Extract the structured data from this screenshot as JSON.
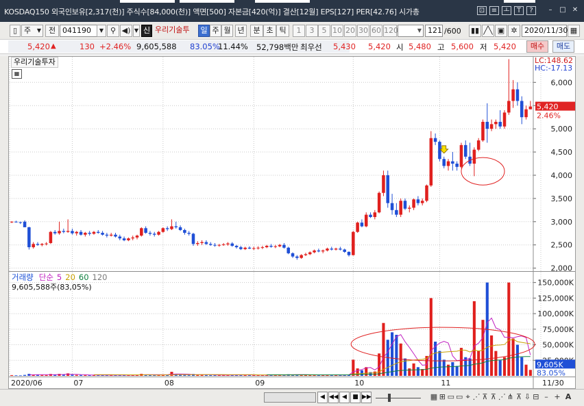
{
  "titlebar": {
    "text": "KOSDAQ150  외국인보유[2,317(천)]  주식수[84,000(천)]  액면[500]  자본금[420(억)]  결산[12월]  EPS[127]  PER[42.76]  시가총",
    "buttons": [
      "⊡",
      "≡",
      "ㅗ",
      "T",
      "?"
    ],
    "window_buttons": [
      "–",
      "□",
      "✕"
    ]
  },
  "toolbar": {
    "period_label": "주",
    "prev_label": "전",
    "code_value": "041190",
    "new_label": "신",
    "company_name": "우리기술투",
    "periods": [
      "일",
      "주",
      "월",
      "년",
      "분",
      "초",
      "틱"
    ],
    "active_period": "일",
    "intervals": [
      "1",
      "3",
      "5",
      "10",
      "20",
      "30",
      "60",
      "120"
    ],
    "count_value": "121",
    "count_total": "/600",
    "date_value": "2020/11/30"
  },
  "quote": {
    "price": "5,420",
    "change": "130",
    "change_pct": "+2.46%",
    "volume": "9,605,588",
    "vol_ratio": "83.05%",
    "turnover": "11.44%",
    "amount": "52,798백만",
    "best_ask_label": "최우선",
    "best_ask": "5,430",
    "best_bid": "5,420",
    "open_label": "시",
    "open": "5,480",
    "high_label": "고",
    "high": "5,600",
    "low_label": "저",
    "low": "5,420",
    "buy_label": "매수",
    "sell_label": "매도"
  },
  "bottombar": {
    "nav": [
      "◀",
      "▶▶",
      "◀",
      "■",
      "▶▶"
    ],
    "tools": [
      "▦",
      "⊞",
      "▭",
      "▭",
      "⌖",
      "⋰",
      "⊼",
      "⊼",
      "⋰",
      "⋔",
      "⊼",
      "⇩",
      "⊟"
    ],
    "zoom_minus": "–",
    "zoom_plus": "+",
    "text_tool": "A"
  },
  "chart_data": [
    {
      "type": "candlestick",
      "title": "우리기술투자",
      "annotations": {
        "lc": "LC:148.62",
        "hc": "HC:-17.13"
      },
      "last_price_label": "5,420",
      "last_change_label": "2.46%",
      "ylim": [
        1950,
        6550
      ],
      "yticks": [
        2000,
        2500,
        3000,
        3500,
        4000,
        4500,
        5000,
        5500,
        6000
      ],
      "ytick_labels": [
        "2,000",
        "2,500",
        "3,000",
        "3,500",
        "4,000",
        "4,500",
        "5,000",
        "5,500",
        "6,000"
      ],
      "x_labels": [
        {
          "text": "2020/06",
          "i": 0
        },
        {
          "text": "07",
          "i": 14
        },
        {
          "text": "08",
          "i": 35
        },
        {
          "text": "09",
          "i": 56
        },
        {
          "text": "10",
          "i": 79
        },
        {
          "text": "11",
          "i": 99
        },
        {
          "text": "11/30",
          "i": 120
        }
      ],
      "candles": [
        [
          2990,
          3010,
          2970,
          3000
        ],
        [
          3000,
          3020,
          2980,
          2990
        ],
        [
          2990,
          3000,
          2950,
          2980
        ],
        [
          3000,
          3030,
          2960,
          2880
        ],
        [
          2880,
          2890,
          2400,
          2450
        ],
        [
          2450,
          2560,
          2420,
          2520
        ],
        [
          2520,
          2560,
          2480,
          2500
        ],
        [
          2500,
          2540,
          2470,
          2520
        ],
        [
          2520,
          2560,
          2490,
          2530
        ],
        [
          2540,
          2800,
          2520,
          2780
        ],
        [
          2780,
          2820,
          2720,
          2750
        ],
        [
          2750,
          3000,
          2720,
          2800
        ],
        [
          2800,
          2850,
          2750,
          2780
        ],
        [
          2780,
          3050,
          2760,
          2800
        ],
        [
          2800,
          2850,
          2720,
          2750
        ],
        [
          2750,
          2800,
          2700,
          2780
        ],
        [
          2780,
          2820,
          2700,
          2720
        ],
        [
          2720,
          2780,
          2680,
          2760
        ],
        [
          2760,
          2800,
          2700,
          2740
        ],
        [
          2740,
          2800,
          2720,
          2780
        ],
        [
          2780,
          2820,
          2740,
          2760
        ],
        [
          2760,
          2800,
          2700,
          2720
        ],
        [
          2720,
          2760,
          2660,
          2700
        ],
        [
          2700,
          2760,
          2680,
          2720
        ],
        [
          2720,
          2760,
          2660,
          2680
        ],
        [
          2680,
          2720,
          2600,
          2640
        ],
        [
          2640,
          2680,
          2580,
          2600
        ],
        [
          2600,
          2660,
          2580,
          2640
        ],
        [
          2640,
          2700,
          2600,
          2660
        ],
        [
          2660,
          2720,
          2620,
          2700
        ],
        [
          2700,
          2880,
          2680,
          2860
        ],
        [
          2860,
          2900,
          2740,
          2760
        ],
        [
          2760,
          2800,
          2700,
          2740
        ],
        [
          2740,
          2780,
          2680,
          2720
        ],
        [
          2720,
          2800,
          2700,
          2780
        ],
        [
          2780,
          2880,
          2760,
          2860
        ],
        [
          2860,
          2900,
          2800,
          2840
        ],
        [
          2840,
          3050,
          2820,
          2900
        ],
        [
          2900,
          3000,
          2850,
          2880
        ],
        [
          2880,
          2920,
          2800,
          2820
        ],
        [
          2820,
          2850,
          2720,
          2760
        ],
        [
          2760,
          2800,
          2700,
          2740
        ],
        [
          2740,
          2760,
          2480,
          2520
        ],
        [
          2520,
          2580,
          2480,
          2540
        ],
        [
          2540,
          2600,
          2500,
          2560
        ],
        [
          2560,
          2600,
          2500,
          2520
        ],
        [
          2520,
          2560,
          2480,
          2500
        ],
        [
          2500,
          2540,
          2460,
          2490
        ],
        [
          2490,
          2520,
          2460,
          2500
        ],
        [
          2500,
          2540,
          2480,
          2510
        ],
        [
          2510,
          2560,
          2480,
          2530
        ],
        [
          2530,
          2560,
          2460,
          2480
        ],
        [
          2480,
          2500,
          2420,
          2450
        ],
        [
          2450,
          2480,
          2390,
          2410
        ],
        [
          2410,
          2460,
          2390,
          2440
        ],
        [
          2440,
          2470,
          2410,
          2420
        ],
        [
          2420,
          2460,
          2390,
          2430
        ],
        [
          2430,
          2470,
          2400,
          2440
        ],
        [
          2440,
          2480,
          2410,
          2450
        ],
        [
          2450,
          2500,
          2430,
          2480
        ],
        [
          2480,
          2520,
          2440,
          2460
        ],
        [
          2460,
          2500,
          2430,
          2470
        ],
        [
          2470,
          2520,
          2450,
          2500
        ],
        [
          2500,
          2540,
          2420,
          2440
        ],
        [
          2440,
          2460,
          2300,
          2320
        ],
        [
          2320,
          2340,
          2220,
          2250
        ],
        [
          2250,
          2280,
          2180,
          2220
        ],
        [
          2220,
          2300,
          2200,
          2280
        ],
        [
          2280,
          2330,
          2260,
          2300
        ],
        [
          2300,
          2360,
          2280,
          2340
        ],
        [
          2340,
          2400,
          2320,
          2380
        ],
        [
          2380,
          2420,
          2340,
          2360
        ],
        [
          2360,
          2400,
          2320,
          2380
        ],
        [
          2380,
          2440,
          2360,
          2420
        ],
        [
          2420,
          2460,
          2380,
          2400
        ],
        [
          2400,
          2440,
          2380,
          2420
        ],
        [
          2420,
          2460,
          2380,
          2400
        ],
        [
          2400,
          2420,
          2330,
          2350
        ],
        [
          2350,
          2360,
          2250,
          2280
        ],
        [
          2280,
          2800,
          2270,
          2780
        ],
        [
          2780,
          3000,
          2760,
          2980
        ],
        [
          2980,
          3050,
          2880,
          2900
        ],
        [
          2900,
          3200,
          2880,
          3150
        ],
        [
          3150,
          3200,
          3080,
          3100
        ],
        [
          3100,
          3250,
          3050,
          3200
        ],
        [
          3200,
          3650,
          3180,
          3620
        ],
        [
          3620,
          4100,
          3550,
          4000
        ],
        [
          4000,
          4100,
          3300,
          3400
        ],
        [
          3400,
          3600,
          3150,
          3250
        ],
        [
          3250,
          3400,
          3100,
          3150
        ],
        [
          3150,
          3500,
          3100,
          3450
        ],
        [
          3450,
          3500,
          3250,
          3280
        ],
        [
          3280,
          3350,
          3200,
          3300
        ],
        [
          3300,
          3500,
          3250,
          3480
        ],
        [
          3480,
          3550,
          3350,
          3400
        ],
        [
          3400,
          3500,
          3350,
          3450
        ],
        [
          3450,
          3800,
          3420,
          3780
        ],
        [
          3780,
          4950,
          3750,
          4800
        ],
        [
          4800,
          4900,
          4650,
          4720
        ],
        [
          4720,
          4750,
          4300,
          4350
        ],
        [
          4350,
          4400,
          4150,
          4200
        ],
        [
          4200,
          4350,
          4100,
          4300
        ],
        [
          4300,
          4500,
          4100,
          4250
        ],
        [
          4250,
          4300,
          4100,
          4180
        ],
        [
          4180,
          4700,
          4150,
          4650
        ],
        [
          4650,
          4750,
          4350,
          4400
        ],
        [
          4400,
          4700,
          4200,
          4250
        ],
        [
          4250,
          4600,
          3980,
          4550
        ],
        [
          4550,
          4800,
          4520,
          4750
        ],
        [
          4750,
          5200,
          4720,
          5150
        ],
        [
          5150,
          5550,
          4700,
          5000
        ],
        [
          5000,
          5200,
          4950,
          5100
        ],
        [
          5100,
          5200,
          5000,
          5150
        ],
        [
          5150,
          5400,
          5000,
          5050
        ],
        [
          5050,
          5400,
          5000,
          5350
        ],
        [
          5350,
          6500,
          5300,
          5600
        ],
        [
          5600,
          6050,
          5450,
          5850
        ],
        [
          5850,
          6000,
          5500,
          5600
        ],
        [
          5600,
          5700,
          5100,
          5250
        ],
        [
          5250,
          5500,
          5200,
          5420
        ],
        [
          5420,
          5600,
          5420,
          5480
        ]
      ],
      "arrow_index": 100,
      "ellipse": {
        "i0": 104.5,
        "i1": 114.5,
        "y0": 3790,
        "y1": 4380
      },
      "legend": [
        {
          "text": "거래량",
          "color": "#1a4fd6"
        },
        {
          "text": "단순",
          "color": "#c020c0"
        },
        {
          "text": "5",
          "color": "#c020c0"
        },
        {
          "text": "20",
          "color": "#c8a000"
        },
        {
          "text": "60",
          "color": "#108040"
        },
        {
          "text": "120",
          "color": "#7a7a7a"
        }
      ],
      "volume_caption": "9,605,588주(83,05%)",
      "volume_last_label": "9,605K",
      "volume_last_pct": "83.05%",
      "vol_ylim": [
        0,
        165000
      ],
      "vol_yticks": [
        25000,
        50000,
        75000,
        100000,
        125000,
        150000
      ],
      "vol_ytick_labels": [
        "25,000K",
        "50,000K",
        "75,000K",
        "100,000K",
        "125,000K",
        "150,000K"
      ],
      "volumes": [
        1200,
        900,
        800,
        1500,
        3200,
        2200,
        1600,
        1400,
        1300,
        3000,
        2000,
        3200,
        1800,
        4000,
        1900,
        1500,
        1400,
        1300,
        1200,
        1500,
        1300,
        1200,
        1100,
        1300,
        1200,
        1400,
        1200,
        1100,
        1300,
        1400,
        3200,
        2200,
        1500,
        1400,
        1600,
        2300,
        2000,
        6500,
        2500,
        1800,
        1500,
        1300,
        3000,
        2000,
        1600,
        1400,
        1300,
        1200,
        1100,
        1300,
        1400,
        1500,
        1600,
        1900,
        1400,
        1200,
        1100,
        1200,
        1300,
        1500,
        1400,
        1200,
        1400,
        1600,
        2500,
        2200,
        1800,
        1600,
        1500,
        1400,
        1600,
        1500,
        1400,
        1600,
        1500,
        1400,
        1300,
        1600,
        2200,
        26000,
        12000,
        9000,
        14000,
        6000,
        7000,
        36000,
        85000,
        58000,
        70000,
        66000,
        52000,
        28000,
        12000,
        20000,
        14000,
        11000,
        32000,
        125000,
        55000,
        40000,
        26000,
        18000,
        22000,
        16000,
        45000,
        30000,
        28000,
        120000,
        40000,
        90000,
        150000,
        65000,
        40000,
        25000,
        30000,
        150000,
        60000,
        50000,
        30000,
        18000,
        9606
      ],
      "ma5_color": "#c020c0",
      "ma20_color": "#c8a000",
      "ma60_color": "#108040",
      "vol_ellipse": {
        "i0": 79,
        "i1": 121.5,
        "y0": 24000,
        "y1": 78000
      },
      "colors": {
        "up": "#e0201e",
        "down": "#1f4fd6",
        "volume": "#1f4fd6"
      }
    }
  ]
}
